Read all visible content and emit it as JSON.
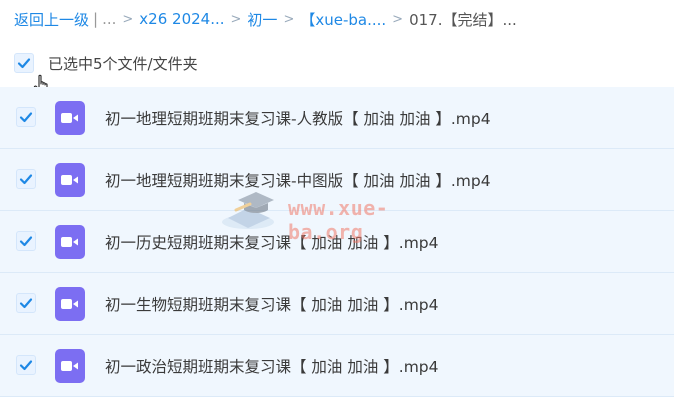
{
  "breadcrumb": {
    "back_label": "返回上一级",
    "divider": "|",
    "ellipsis": "...",
    "sep": ">",
    "items": [
      "x26 2024...",
      "初一",
      "【xue-ba...."
    ],
    "current": "017.【完结】..."
  },
  "selection": {
    "summary": "已选中5个文件/文件夹"
  },
  "files": [
    {
      "name": "初一地理短期班期末复习课-人教版【 加油 加油 】.mp4"
    },
    {
      "name": "初一地理短期班期末复习课-中图版【 加油 加油 】.mp4"
    },
    {
      "name": "初一历史短期班期末复习课【 加油 加油 】.mp4"
    },
    {
      "name": "初一生物短期班期末复习课【 加油 加油 】.mp4"
    },
    {
      "name": "初一政治短期班期末复习课【 加油 加油 】.mp4"
    }
  ],
  "watermark": {
    "text": "www.xue-ba.org"
  },
  "colors": {
    "accent": "#1e88e5",
    "video_icon": "#7c6ef2",
    "row_bg": "#f0f7fe"
  },
  "icons": {
    "checkbox": "check-icon",
    "file": "video-file-icon",
    "cursor": "hand-pointer-icon"
  }
}
